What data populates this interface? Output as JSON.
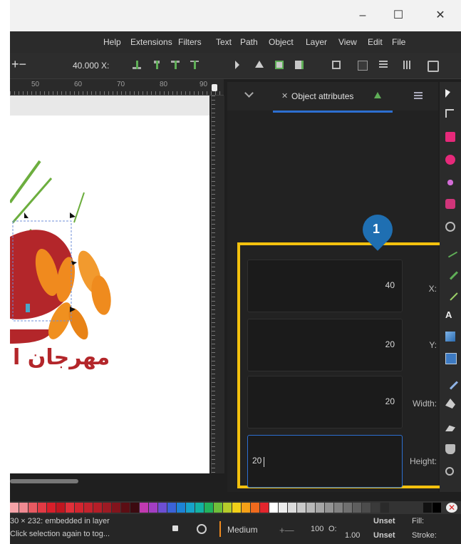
{
  "window": {
    "minimize_glyph": "–",
    "maximize_glyph": "☐",
    "close_glyph": "✕"
  },
  "menu": [
    "Help",
    "Extensions",
    "Filters",
    "Text",
    "Path",
    "Object",
    "Layer",
    "View",
    "Edit",
    "File"
  ],
  "toolbar": {
    "zoom_value": "40.000",
    "x_label": "X:"
  },
  "ruler": [
    "50",
    "60",
    "70",
    "80",
    "90"
  ],
  "canvas": {
    "arabic_text": "مهرجان ا"
  },
  "panel": {
    "tab_label": "Object attributes",
    "step_badge": "1",
    "fields": [
      {
        "label": "X:",
        "value": "40"
      },
      {
        "label": "Y:",
        "value": "20"
      },
      {
        "label": "Width:",
        "value": "20"
      },
      {
        "label": "Height:",
        "value": "20"
      }
    ]
  },
  "status": {
    "line1": "30 × 232: embedded in layer",
    "line2": "Click selection again to tog...",
    "stroke_width": "Medium",
    "opacity_value": "100",
    "opacity_label": "O:",
    "stroke_value": "1.00",
    "fill_value": "Unset",
    "fill_label": "Fill:",
    "stroke_paint_value": "Unset",
    "stroke_label": "Stroke:"
  },
  "colors": {
    "highlight": "#f3c10e",
    "badge": "#1f6fb2",
    "focus_border": "#2d6fd0",
    "logo_red": "#b3262a",
    "logo_orange": "#f08a1e",
    "leaf_green": "#6cae3e"
  }
}
